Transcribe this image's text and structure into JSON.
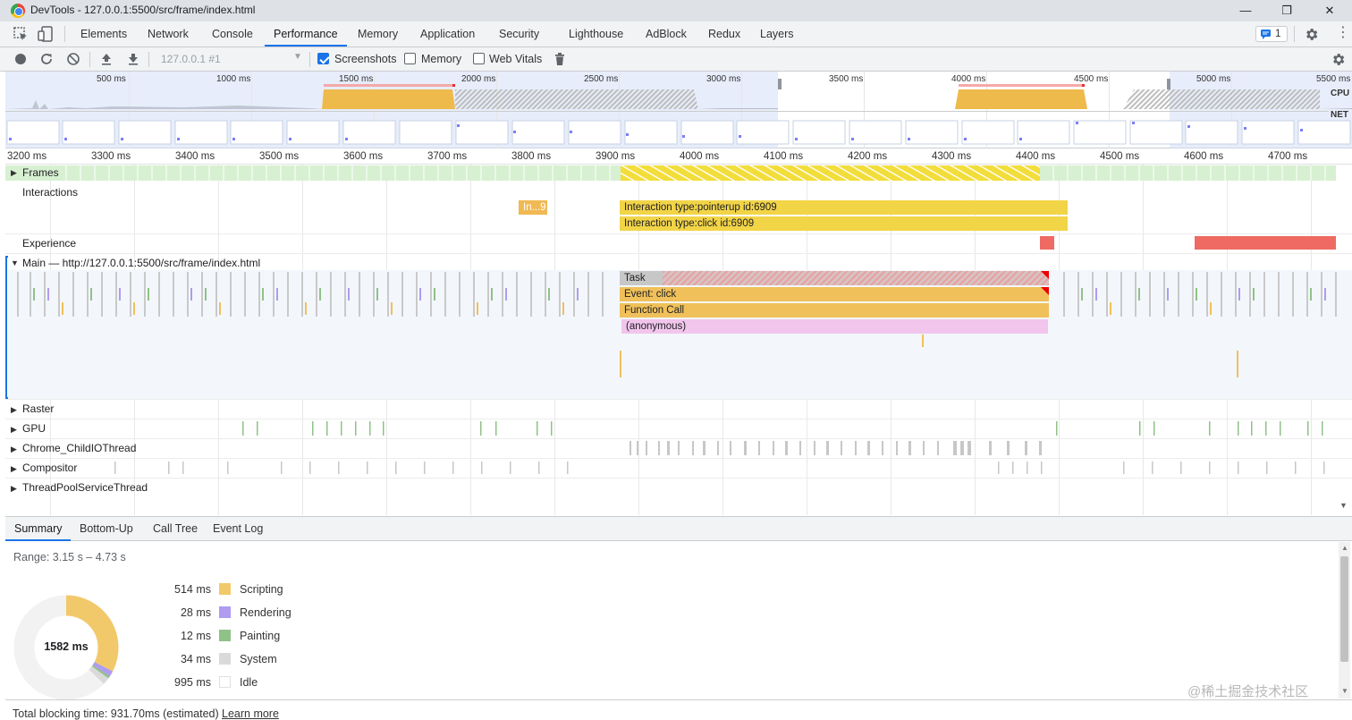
{
  "window": {
    "title": "DevTools - 127.0.0.1:5500/src/frame/index.html",
    "minimize": "—",
    "maximize": "❐",
    "close": "✕"
  },
  "tabs": [
    {
      "label": "Elements"
    },
    {
      "label": "Network"
    },
    {
      "label": "Console"
    },
    {
      "label": "Performance",
      "active": true
    },
    {
      "label": "Memory"
    },
    {
      "label": "Application"
    },
    {
      "label": "Security"
    },
    {
      "label": "Lighthouse"
    },
    {
      "label": "AdBlock"
    },
    {
      "label": "Redux"
    },
    {
      "label": "Layers"
    }
  ],
  "issues_badge": "1",
  "toolbar": {
    "target": "127.0.0.1 #1",
    "screenshots_label": "Screenshots",
    "screenshots_checked": true,
    "memory_label": "Memory",
    "memory_checked": false,
    "webvitals_label": "Web Vitals",
    "webvitals_checked": false
  },
  "overview": {
    "ticks": [
      "500 ms",
      "1000 ms",
      "1500 ms",
      "2000 ms",
      "2500 ms",
      "3000 ms",
      "3500 ms",
      "4000 ms",
      "4500 ms",
      "5000 ms",
      "5500 ms"
    ],
    "cpu_label": "CPU",
    "net_label": "NET"
  },
  "ruler": {
    "ticks": [
      "3200 ms",
      "3300 ms",
      "3400 ms",
      "3500 ms",
      "3600 ms",
      "3700 ms",
      "3800 ms",
      "3900 ms",
      "4000 ms",
      "4100 ms",
      "4200 ms",
      "4300 ms",
      "4400 ms",
      "4500 ms",
      "4600 ms",
      "4700 ms"
    ]
  },
  "tracks": {
    "frames": "Frames",
    "interactions": "Interactions",
    "experience": "Experience",
    "main": "Main — http://127.0.0.1:5500/src/frame/index.html",
    "raster": "Raster",
    "gpu": "GPU",
    "childio": "Chrome_ChildIOThread",
    "compositor": "Compositor",
    "threadpool": "ThreadPoolServiceThread"
  },
  "interactions": {
    "short": "In...9",
    "pointerup": "Interaction type:pointerup id:6909",
    "click": "Interaction type:click id:6909"
  },
  "flame": {
    "task": "Task",
    "event": "Event: click",
    "function_call": "Function Call",
    "anonymous": "(anonymous)"
  },
  "bottom_tabs": [
    {
      "label": "Summary",
      "active": true
    },
    {
      "label": "Bottom-Up"
    },
    {
      "label": "Call Tree"
    },
    {
      "label": "Event Log"
    }
  ],
  "summary": {
    "range": "Range: 3.15 s – 4.73 s",
    "total": "1582 ms",
    "items": [
      {
        "value": "514 ms",
        "name": "Scripting",
        "color": "#f2c96a"
      },
      {
        "value": "28 ms",
        "name": "Rendering",
        "color": "#af9bf0"
      },
      {
        "value": "12 ms",
        "name": "Painting",
        "color": "#8fc287"
      },
      {
        "value": "34 ms",
        "name": "System",
        "color": "#dadada"
      },
      {
        "value": "995 ms",
        "name": "Idle",
        "color": "#ffffff"
      }
    ]
  },
  "footer": {
    "tbt": "Total blocking time: 931.70ms (estimated)",
    "learn_more": "Learn more"
  },
  "watermark": "@稀土掘金技术社区"
}
